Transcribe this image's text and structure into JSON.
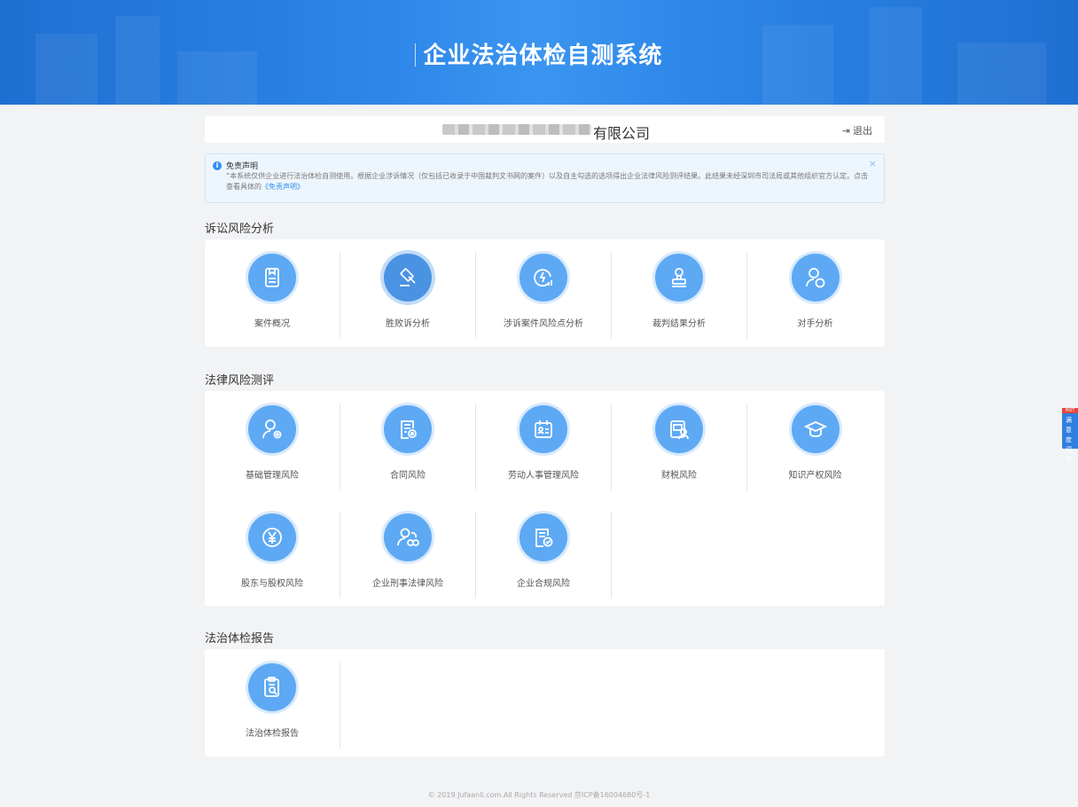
{
  "app": {
    "title": "企业法治体检自测系统"
  },
  "company": {
    "name_suffix": "有限公司",
    "logout_label": "退出"
  },
  "notice": {
    "title": "免责声明",
    "text": "“本系统仅供企业进行法治体检自测使用。根据企业涉诉情况（仅包括已收录于中国裁判文书网的案件）以及自主勾选的选项得出企业法律风险测评结果。此结果未经深圳市司法局或其他组织官方认定。点击查看具体的",
    "link": "《免责声明》",
    "close": "×"
  },
  "sections": {
    "litigation": {
      "title": "诉讼风险分析",
      "items": [
        {
          "label": "案件概况",
          "icon": "document-icon"
        },
        {
          "label": "胜败诉分析",
          "icon": "gavel-icon"
        },
        {
          "label": "涉诉案件风险点分析",
          "icon": "risk-chart-icon"
        },
        {
          "label": "裁判结果分析",
          "icon": "seal-stamp-icon"
        },
        {
          "label": "对手分析",
          "icon": "user-vs-icon"
        }
      ]
    },
    "legal": {
      "title": "法律风险测评",
      "items": [
        {
          "label": "基础管理风险",
          "icon": "user-gear-icon"
        },
        {
          "label": "合同风险",
          "icon": "contract-icon"
        },
        {
          "label": "劳动人事管理风险",
          "icon": "calendar-card-icon"
        },
        {
          "label": "财税风险",
          "icon": "tax-icon"
        },
        {
          "label": "知识产权风险",
          "icon": "graduation-cap-icon"
        },
        {
          "label": "股东与股权风险",
          "icon": "yen-icon"
        },
        {
          "label": "企业刑事法律风险",
          "icon": "handcuff-user-icon"
        },
        {
          "label": "企业合规风险",
          "icon": "compliance-doc-icon"
        }
      ]
    },
    "report": {
      "title": "法治体检报告",
      "items": [
        {
          "label": "法治体检报告",
          "icon": "report-search-icon"
        }
      ]
    }
  },
  "footer": {
    "text": "© 2019 Jufaanli.com.All Rights Reserved 京ICP备16004680号-1"
  },
  "side_tab": {
    "badge": "HOT",
    "text": "满意度调查"
  },
  "colors": {
    "banner": "#2d86e8",
    "icon": "#5ea9f4",
    "link": "#2f8ff0"
  }
}
